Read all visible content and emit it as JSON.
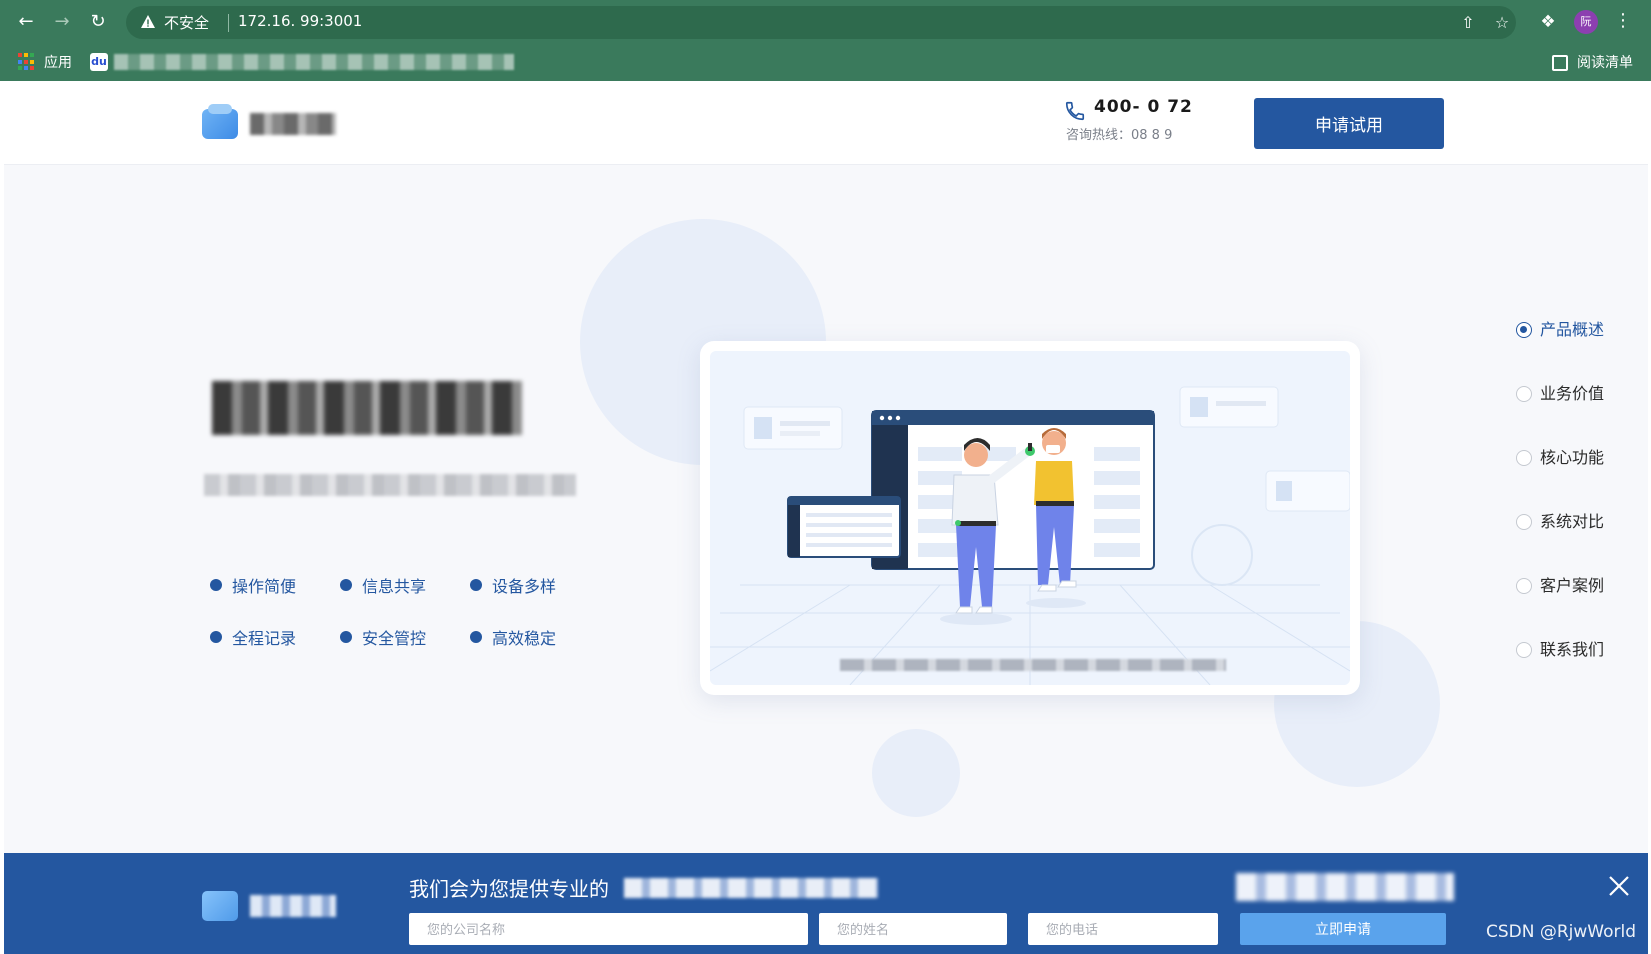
{
  "browser": {
    "security_label": "不安全",
    "url": "172.16.  99:3001",
    "avatar_text": "阮",
    "apps_label": "应用",
    "reading_list_label": "阅读清单"
  },
  "header": {
    "phone_number": "400-  0  72",
    "hotline": "咨询热线：08       8   9",
    "cta": "申请试用"
  },
  "hero": {
    "features": [
      "操作简便",
      "信息共享",
      "设备多样",
      "全程记录",
      "安全管控",
      "高效稳定"
    ]
  },
  "side_nav": {
    "items": [
      {
        "label": "产品概述",
        "active": true
      },
      {
        "label": "业务价值",
        "active": false
      },
      {
        "label": "核心功能",
        "active": false
      },
      {
        "label": "系统对比",
        "active": false
      },
      {
        "label": "客户案例",
        "active": false
      },
      {
        "label": "联系我们",
        "active": false
      }
    ]
  },
  "banner": {
    "message": "我们会为您提供专业的",
    "company_placeholder": "您的公司名称",
    "name_placeholder": "您的姓名",
    "phone_placeholder": "您的电话",
    "submit": "立即申请"
  },
  "watermark": "CSDN @RjwWorld",
  "colors": {
    "chrome": "#3a7a5c",
    "primary": "#2457a0",
    "submit": "#5aa3ec",
    "page_bg": "#f7f8fb"
  }
}
